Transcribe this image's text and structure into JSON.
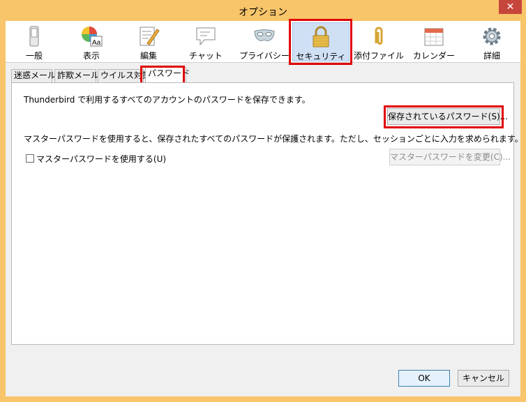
{
  "window": {
    "title": "オプション",
    "close_glyph": "✕"
  },
  "toolbar": {
    "items": [
      {
        "label": "一般",
        "icon": "switch-icon"
      },
      {
        "label": "表示",
        "icon": "palette-icon"
      },
      {
        "label": "編集",
        "icon": "edit-icon"
      },
      {
        "label": "チャット",
        "icon": "chat-icon"
      },
      {
        "label": "プライバシー",
        "icon": "mask-icon"
      },
      {
        "label": "セキュリティ",
        "icon": "lock-icon"
      },
      {
        "label": "添付ファイル",
        "icon": "paperclip-icon"
      },
      {
        "label": "カレンダー",
        "icon": "calendar-icon"
      },
      {
        "label": "詳細",
        "icon": "gear-icon"
      }
    ],
    "active": "セキュリティ"
  },
  "tabs": [
    {
      "label": "迷惑メール"
    },
    {
      "label": "詐欺メール"
    },
    {
      "label": "ウイルス対策"
    },
    {
      "label": "パスワード"
    }
  ],
  "panel": {
    "desc": "Thunderbird で利用するすべてのアカウントのパスワードを保存できます。",
    "saved_passwords_button": "保存されているパスワード(S)...",
    "master_desc": "マスターパスワードを使用すると、保存されたすべてのパスワードが保護されます。ただし、セッションごとに入力を求められます。",
    "use_master_label": "マスターパスワードを使用する(U)",
    "use_master_checked": false,
    "change_master_button": "マスターパスワードを変更(C)..."
  },
  "footer": {
    "ok": "OK",
    "cancel": "キャンセル"
  },
  "colors": {
    "titlebar": "#f8c56b",
    "highlight": "#e00000",
    "active_tab_bg": "#cfe0f5"
  }
}
